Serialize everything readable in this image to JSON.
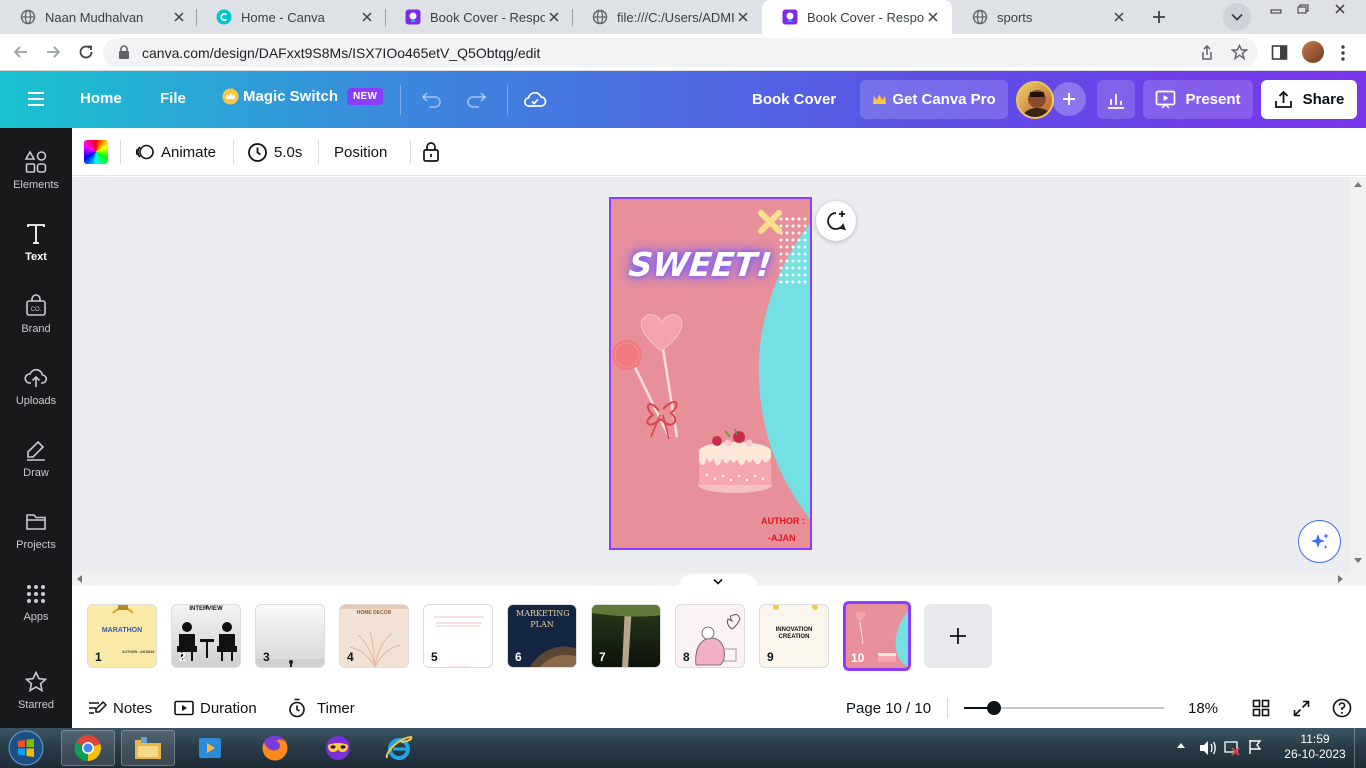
{
  "browser": {
    "tabs": [
      {
        "title": "Naan Mudhalvan",
        "icon": "globe-icon"
      },
      {
        "title": "Home - Canva",
        "icon": "canva-icon"
      },
      {
        "title": "Book Cover - Responsi",
        "icon": "canva-design-icon"
      },
      {
        "title": "file:///C:/Users/ADMIN/",
        "icon": "globe-icon"
      },
      {
        "title": "Book Cover - Responsi",
        "icon": "canva-design-icon",
        "active": true
      },
      {
        "title": "sports",
        "icon": "globe-icon"
      }
    ],
    "url": "canva.com/design/DAFxxt9S8Ms/ISX7IOo465etV_Q5Obtqg/edit"
  },
  "header": {
    "home": "Home",
    "file": "File",
    "magic_switch": "Magic Switch",
    "new_badge": "NEW",
    "doc_title": "Book Cover",
    "get_pro": "Get Canva Pro",
    "present": "Present",
    "share": "Share"
  },
  "sidebar": {
    "items": [
      {
        "label": "Elements",
        "icon": "elements-icon"
      },
      {
        "label": "Text",
        "icon": "text-icon",
        "active": true
      },
      {
        "label": "Brand",
        "icon": "brand-icon"
      },
      {
        "label": "Uploads",
        "icon": "upload-icon"
      },
      {
        "label": "Draw",
        "icon": "draw-icon"
      },
      {
        "label": "Projects",
        "icon": "folder-icon"
      },
      {
        "label": "Apps",
        "icon": "apps-icon"
      },
      {
        "label": "Starred",
        "icon": "star-icon"
      }
    ]
  },
  "toolbar": {
    "animate": "Animate",
    "duration": "5.0s",
    "position": "Position"
  },
  "design": {
    "headline": "SWEET!",
    "author_label": "AUTHOR :",
    "author_name": "-AJAN",
    "colors": {
      "background": "#e8909a",
      "accent": "#74e0e2",
      "headline": "#7b5cf0",
      "author": "#e0161f"
    }
  },
  "pages": {
    "thumbnails": [
      {
        "number": "1",
        "label": "MARATHON",
        "sub": "AUTHOR: -AKSHAY"
      },
      {
        "number": "2",
        "label": "INTERVIEW"
      },
      {
        "number": "3",
        "label": ""
      },
      {
        "number": "4",
        "label": "HOME DECOR"
      },
      {
        "number": "5",
        "label": ""
      },
      {
        "number": "6",
        "label": "MARKETING PLAN"
      },
      {
        "number": "7",
        "label": ""
      },
      {
        "number": "8",
        "label": ""
      },
      {
        "number": "9",
        "label": "INNOVATION CREATION"
      },
      {
        "number": "10",
        "label": "",
        "active": true
      }
    ]
  },
  "footer": {
    "notes": "Notes",
    "duration": "Duration",
    "timer": "Timer",
    "page_indicator": "Page 10 / 10",
    "zoom_percent": "18%",
    "zoom_fraction": 0.15
  },
  "taskbar": {
    "time": "11:59",
    "date": "26-10-2023",
    "apps": [
      "start-orb-icon",
      "chrome-icon",
      "file-explorer-icon",
      "media-player-icon",
      "firefox-icon",
      "mask-app-icon",
      "internet-explorer-icon"
    ]
  }
}
